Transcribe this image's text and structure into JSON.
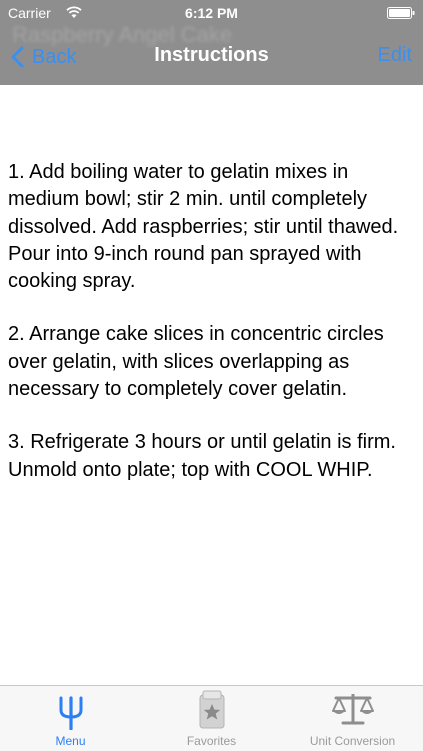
{
  "status_bar": {
    "carrier": "Carrier",
    "time": "6:12 PM"
  },
  "nav": {
    "background_title": "Raspberry Angel Cake",
    "back_label": "Back",
    "title": "Instructions",
    "edit_label": "Edit"
  },
  "instructions": [
    "1. Add boiling water to gelatin mixes in medium bowl; stir 2 min. until completely dissolved. Add raspberries; stir until thawed. Pour into 9-inch round pan sprayed with cooking spray.",
    "2. Arrange cake slices in concentric circles over gelatin, with slices overlapping as necessary to completely cover gelatin.",
    "3. Refrigerate 3 hours or until gelatin is firm. Unmold onto plate; top with COOL WHIP."
  ],
  "tabs": [
    {
      "label": "Menu",
      "icon": "fork-icon",
      "selected": true
    },
    {
      "label": "Favorites",
      "icon": "recipe-card-star-icon",
      "selected": false
    },
    {
      "label": "Unit Conversion",
      "icon": "scale-icon",
      "selected": false
    }
  ],
  "colors": {
    "header": "#8e8e8e",
    "accent": "#3b8ff0",
    "tab_inactive": "#9b9b9b",
    "tab_bar": "#f7f7f7"
  }
}
